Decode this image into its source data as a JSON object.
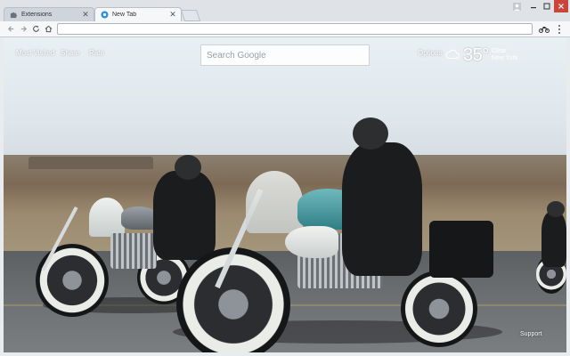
{
  "browser": {
    "tabs": [
      {
        "label": "Extensions",
        "icon": "puzzle-icon",
        "active": false
      },
      {
        "label": "New Tab",
        "icon": "new-tab-icon",
        "active": true
      }
    ],
    "address_bar": {
      "value": ""
    },
    "window_controls": {
      "close_color": "#c9453a"
    }
  },
  "page": {
    "nav_links": [
      "Most Visited",
      "Share",
      "Rate"
    ],
    "search": {
      "placeholder": "Search Google"
    },
    "options_label": "Options",
    "weather": {
      "icon": "cloud-icon",
      "temperature": "35°",
      "unit": "F",
      "condition": "Clear",
      "location": "New York"
    },
    "support_label": "Support"
  }
}
